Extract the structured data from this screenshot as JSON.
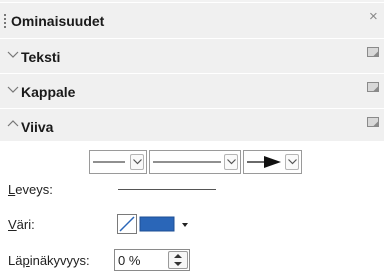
{
  "panel": {
    "title": "Ominaisuudet",
    "close_glyph": "×"
  },
  "sections": {
    "text": {
      "title": "Teksti",
      "expanded": false
    },
    "paragraph": {
      "title": "Kappale",
      "expanded": false
    },
    "line": {
      "title": "Viiva",
      "expanded": true
    }
  },
  "line_panel": {
    "width": {
      "label_underlined": "L",
      "label_rest": "eveys:"
    },
    "color": {
      "label_underlined": "V",
      "label_rest": "äri:",
      "value_hex": "#2a66b8"
    },
    "transparency": {
      "label_before": "Lä",
      "label_underlined": "p",
      "label_rest": "inäkyvyys:",
      "value": "0 %"
    }
  },
  "icons": {
    "collapsed": "chevron-down-icon",
    "expanded": "chevron-up-icon",
    "more_options": "more-options-icon"
  },
  "colors": {
    "section_bg": "#f0f0f0",
    "line_color": "#2a66b8"
  }
}
